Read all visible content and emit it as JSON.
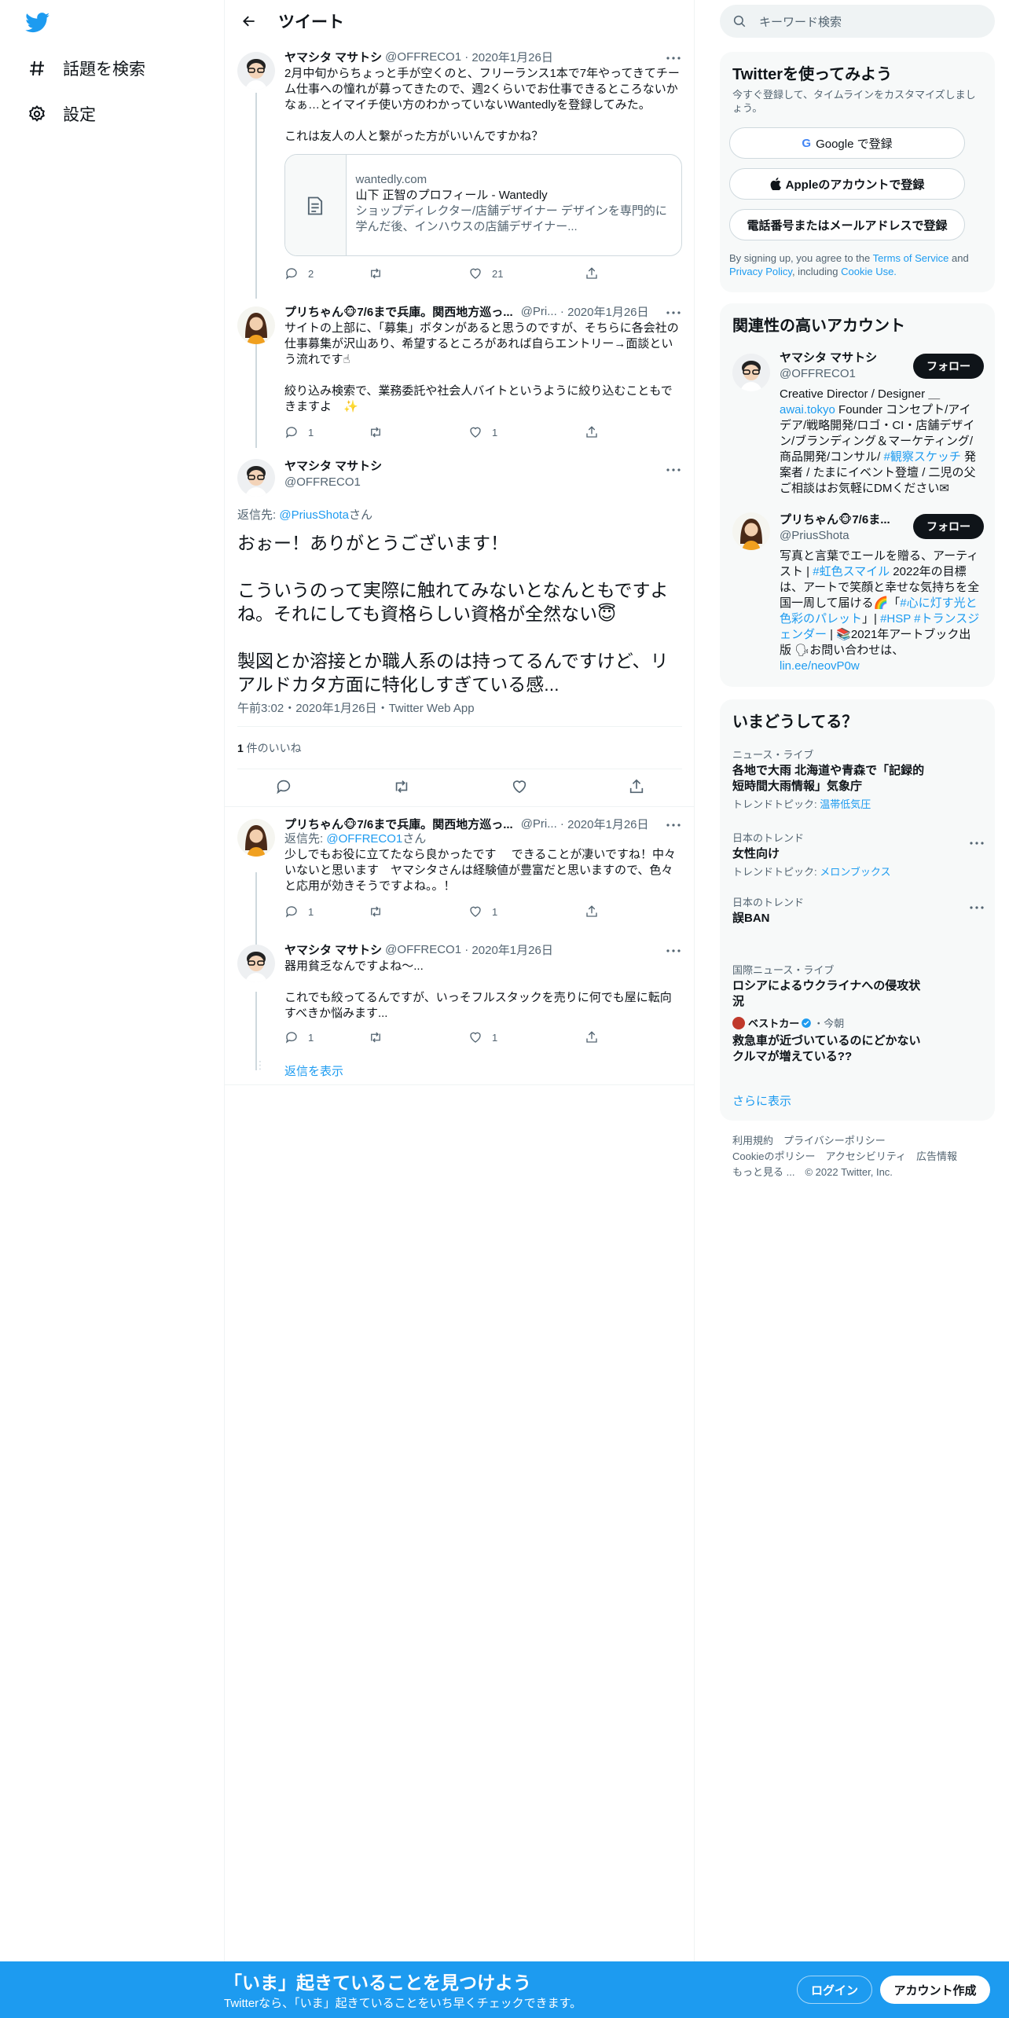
{
  "nav": {
    "explore_label": "話題を検索",
    "settings_label": "設定"
  },
  "main": {
    "header_title": "ツイート",
    "tweets": [
      {
        "name": "ヤマシタ マサトシ",
        "handle": "@OFFRECO1",
        "date": "2020年1月26日",
        "text": "2月中旬からちょっと手が空くのと、フリーランス1本で7年やってきてチーム仕事への憧れが募ってきたので、週2くらいでお仕事できるところないかなぁ…とイマイチ使い方のわかっていないWantedlyを登録してみた。\n\nこれは友人の人と繋がった方がいいんですかね？",
        "card": {
          "domain": "wantedly.com",
          "title": "山下 正智のプロフィール - Wantedly",
          "desc": "ショップディレクター/店舗デザイナー デザインを専門的に学んだ後、インハウスの店舗デザイナー..."
        },
        "replies": "2",
        "retweets": "",
        "likes": "21"
      },
      {
        "name": "プリちゃん🐵7/6まで兵庫。関西地方巡っ...",
        "handle": "@Pri...",
        "date": "2020年1月26日",
        "text": "サイトの上部に、「募集」ボタンがあると思うのですが、そちらに各会社の仕事募集が沢山あり、希望するところがあれば自らエントリー→面談という流れです☝\n\n絞り込み検索で、業務委託や社会人バイトというように絞り込むこともできますよ　✨",
        "replies": "1",
        "retweets": "",
        "likes": "1"
      }
    ],
    "focus": {
      "name": "ヤマシタ マサトシ",
      "handle": "@OFFRECO1",
      "reply_prefix": "返信先: ",
      "reply_to": "@PriusShota",
      "reply_suffix": "さん",
      "text": "おぉー！ありがとうございます！\n\nこういうのって実際に触れてみないとなんともですよね。それにしても資格らしい資格が全然ない😇\n\n製図とか溶接とか職人系のは持ってるんですけど、リアルドカタ方面に特化しすぎている感...",
      "meta": "午前3:02・2020年1月26日・Twitter Web App",
      "likes_count": "1",
      "likes_label": " 件のいいね"
    },
    "replies": [
      {
        "name": "プリちゃん🐵7/6まで兵庫。関西地方巡っ...",
        "handle": "@Pri...",
        "date": "2020年1月26日",
        "reply_prefix": "返信先: ",
        "reply_to": "@OFFRECO1",
        "reply_suffix": "さん",
        "text": "少しでもお役に立てたなら良かったです　 できることが凄いですね！中々いないと思います　ヤマシタさんは経験値が豊富だと思いますので、色々と応用が効きそうですよね。。！",
        "replies": "1",
        "retweets": "",
        "likes": "1"
      },
      {
        "name": "ヤマシタ マサトシ",
        "handle": "@OFFRECO1",
        "date": "2020年1月26日",
        "text": "器用貧乏なんですよね〜...\n\nこれでも絞ってるんですが、いっそフルスタックを売りに何でも屋に転向すべきか悩みます...",
        "replies": "1",
        "retweets": "",
        "likes": "1"
      }
    ],
    "show_replies": "返信を表示"
  },
  "right": {
    "search_placeholder": "キーワード検索",
    "signup": {
      "title": "Twitterを使ってみよう",
      "subtitle": "今すぐ登録して、タイムラインをカスタマイズしましょう。",
      "google": "Google で登録",
      "apple": "Appleのアカウントで登録",
      "phone": "電話番号またはメールアドレスで登録",
      "terms_pre": "By signing up, you agree to the ",
      "terms": "Terms of Service",
      "and": " and ",
      "privacy": "Privacy Policy",
      "including": ", including ",
      "cookie": "Cookie Use."
    },
    "related": {
      "title": "関連性の高いアカウント",
      "follow_label": "フォロー",
      "accounts": [
        {
          "name": "ヤマシタ マサトシ",
          "handle": "@OFFRECO1",
          "bio_1": "Creative Director / Designer ＿",
          "bio_link": "awai.tokyo",
          "bio_2": " Founder コンセプト/アイデア/戦略開発/ロゴ・CI・店舗デザイン/ブランディング＆マーケティング/商品開発/コンサル/ ",
          "bio_tag": "#観察スケッチ",
          "bio_3": " 発案者 / たまにイベント登壇 / 二児の父 ご相談はお気軽にDMください✉"
        },
        {
          "name": "プリちゃん🐵7/6ま...",
          "handle": "@PriusShota",
          "bio_1": "写真と言葉でエールを贈る、アーティスト | ",
          "bio_tag1": "#虹色スマイル",
          "bio_2": " 2022年の目標は、アートで笑顔と幸せな気持ちを全国一周して届ける🌈「",
          "bio_tag2": "#心に灯す光と色彩のパレット",
          "bio_3": "」| ",
          "bio_tag3": "#HSP #トランスジェンダー",
          "bio_4": " | 📚2021年アートブック出版 🗣お問い合わせは、",
          "bio_link": "lin.ee/neovP0w"
        }
      ]
    },
    "trends": {
      "title": "いまどうしてる？",
      "items": [
        {
          "meta": "ニュース・ライブ",
          "title": "各地で大雨 北海道や青森で「記録的短時間大雨情報」気象庁",
          "topic_label": "トレンドトピック: ",
          "topic": "温帯低気圧"
        },
        {
          "meta": "日本のトレンド",
          "title": "女性向け",
          "topic_label": "トレンドトピック: ",
          "topic": "メロンブックス"
        },
        {
          "meta": "日本のトレンド",
          "title": "誤BAN"
        },
        {
          "meta": "国際ニュース・ライブ",
          "title": "ロシアによるウクライナへの侵攻状況"
        },
        {
          "source": "ベストカー",
          "time": "・今朝",
          "title": "救急車が近づいているのにどかないクルマが増えている??"
        }
      ],
      "show_more": "さらに表示"
    },
    "footer": {
      "l1": "利用規約　プライバシーポリシー",
      "l2": "Cookieのポリシー　アクセシビリティ　広告情報",
      "more": "もっと見る ...",
      "copy": "　© 2022 Twitter, Inc."
    }
  },
  "bottom": {
    "title": "「いま」起きていることを見つけよう",
    "subtitle": "Twitterなら、「いま」起きていることをいち早くチェックできます。",
    "login": "ログイン",
    "signup": "アカウント作成"
  }
}
